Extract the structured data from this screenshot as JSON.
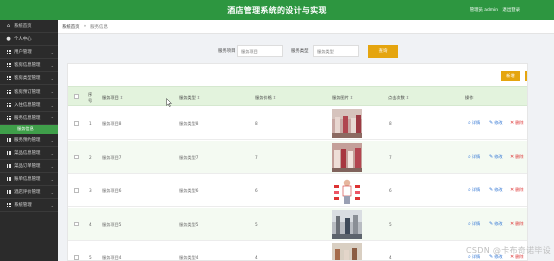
{
  "header": {
    "title": "酒店管理系统的设计与实现",
    "user_label": "管理员 admin",
    "logout": "退出登录"
  },
  "sidebar": {
    "items": [
      {
        "label": "系统首页",
        "icon": "home-icon"
      },
      {
        "label": "个人中心",
        "icon": "user-icon"
      },
      {
        "label": "用户管理",
        "icon": "grid-icon"
      },
      {
        "label": "客房信息管理",
        "icon": "grid-icon"
      },
      {
        "label": "客房类型管理",
        "icon": "grid-icon"
      },
      {
        "label": "客房预订管理",
        "icon": "grid-icon"
      },
      {
        "label": "入住信息管理",
        "icon": "grid-icon"
      },
      {
        "label": "服务信息管理",
        "icon": "grid-icon"
      },
      {
        "label": "服务预约管理",
        "icon": "grid-icon"
      },
      {
        "label": "菜品信息管理",
        "icon": "grid-icon"
      },
      {
        "label": "菜品订单管理",
        "icon": "grid-icon"
      },
      {
        "label": "账单信息管理",
        "icon": "grid-icon"
      },
      {
        "label": "酒店评价管理",
        "icon": "grid-icon"
      },
      {
        "label": "系统管理",
        "icon": "grid-icon"
      }
    ],
    "sub_item": "服务信息"
  },
  "breadcrumb": {
    "home": "系统首页",
    "separator": "»",
    "current": "服务信息"
  },
  "search": {
    "name_label": "服务项目",
    "name_placeholder": "服务项目",
    "type_label": "服务类型",
    "type_placeholder": "服务类型",
    "button": "查询"
  },
  "toolbar": {
    "add": "新增",
    "delete": "删除"
  },
  "table": {
    "columns": [
      "序号",
      "服务项目",
      "服务类型",
      "服务价格",
      "服务图片",
      "点击次数",
      "操作"
    ],
    "rows": [
      {
        "index": "1",
        "name": "服务项目8",
        "type": "服务类型8",
        "price": "8",
        "clicks": "8"
      },
      {
        "index": "2",
        "name": "服务项目7",
        "type": "服务类型7",
        "price": "7",
        "clicks": "7"
      },
      {
        "index": "3",
        "name": "服务项目6",
        "type": "服务类型6",
        "price": "6",
        "clicks": "6"
      },
      {
        "index": "4",
        "name": "服务项目5",
        "type": "服务类型5",
        "price": "5",
        "clicks": "5"
      },
      {
        "index": "5",
        "name": "服务项目4",
        "type": "服务类型4",
        "price": "4",
        "clicks": "4"
      }
    ],
    "actions": {
      "view": "详情",
      "edit": "修改",
      "delete": "删除"
    }
  },
  "watermark": "CSDN @卡布奇诺毕设",
  "colors": {
    "primary": "#2d9640",
    "accent": "#e5a50f",
    "sidebar": "#2b2b2b",
    "header_row": "#e3f3dd"
  }
}
